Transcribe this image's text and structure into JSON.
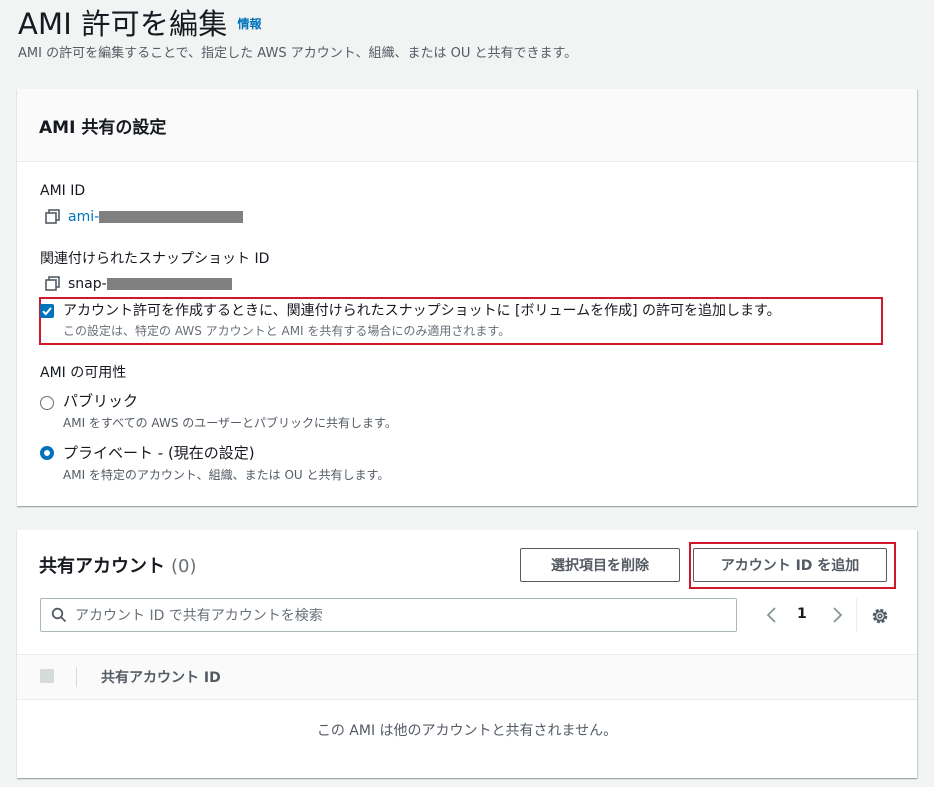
{
  "header": {
    "title": "AMI 許可を編集",
    "info": "情報",
    "subtitle": "AMI の許可を編集することで、指定した AWS アカウント、組織、または OU と共有できます。"
  },
  "sharing": {
    "title": "AMI 共有の設定",
    "ami_id_label": "AMI ID",
    "ami_id_value": "ami-",
    "snapshot_label": "関連付けられたスナップショット ID",
    "snapshot_value": "snap-",
    "volume_permission": {
      "checked": true,
      "label": "アカウント許可を作成するときに、関連付けられたスナップショットに [ボリュームを作成] の許可を追加します。",
      "description": "この設定は、特定の AWS アカウントと AMI を共有する場合にのみ適用されます。"
    },
    "availability_label": "AMI の可用性",
    "options": [
      {
        "label": "パブリック",
        "description": "AMI をすべての AWS のユーザーとパブリックに共有します。",
        "selected": false
      },
      {
        "label": "プライベート - (現在の設定)",
        "description": "AMI を特定のアカウント、組織、または OU と共有します。",
        "selected": true
      }
    ]
  },
  "shared_accounts": {
    "title": "共有アカウント",
    "count": "(0)",
    "remove_button": "選択項目を削除",
    "add_button": "アカウント ID を追加",
    "search_placeholder": "アカウント ID で共有アカウントを検索",
    "page": "1",
    "column_header": "共有アカウント ID",
    "empty_message": "この AMI は他のアカウントと共有されません。"
  },
  "colors": {
    "accent": "#0073bb",
    "highlight": "#d0182a",
    "background": "#f2f3f3"
  }
}
